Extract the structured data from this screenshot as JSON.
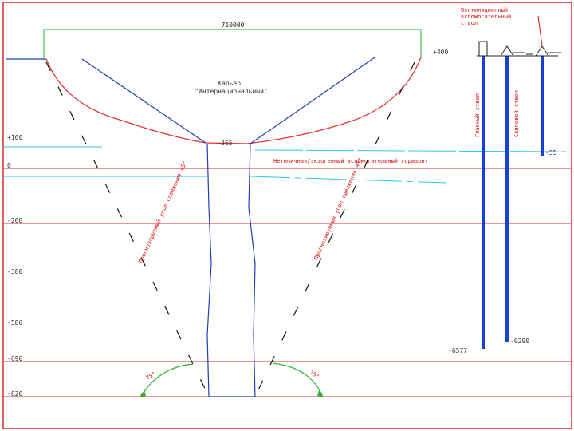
{
  "title_top_right": "Вентиляционный\nвспомогательный\nствол",
  "width_label": "710000",
  "pit_name": "Карьер\n\"Интернациональный\"",
  "mine_label": "Нетипичная/экзогенный вспомогательный горизонт",
  "left_slope_label": "Прогнозируемый угол сдвижения 45°",
  "right_slope_label": "Прогнозируемый угол сдвижения 45°",
  "shaft_main_label": "Главный ствол",
  "shaft_aux_label": "Скиповой ствол",
  "bottom_left_angle": "75°",
  "bottom_right_angle": "75°",
  "pit_bottom_mark": "-365",
  "depth_levels": [
    {
      "label": "+400",
      "side": "right"
    },
    {
      "label": "+100",
      "side": "left"
    },
    {
      "label": "0",
      "side": "left"
    },
    {
      "label": "-200",
      "side": "left"
    },
    {
      "label": "-380",
      "side": "left"
    },
    {
      "label": "-580",
      "side": "left"
    },
    {
      "label": "-690",
      "side": "left"
    },
    {
      "label": "-820",
      "side": "left"
    }
  ],
  "shaft_depth_main": "-6577",
  "shaft_depth_aux": "-0290",
  "shaft_depth_third": "-55",
  "colors": {
    "frame": "#d62b2b",
    "pit": "#e53232",
    "slopes": "#1f3fb3",
    "shafts": "#1a3fd6",
    "water": "#31c6e6",
    "width": "#26b626",
    "arc": "#2fb22f"
  }
}
